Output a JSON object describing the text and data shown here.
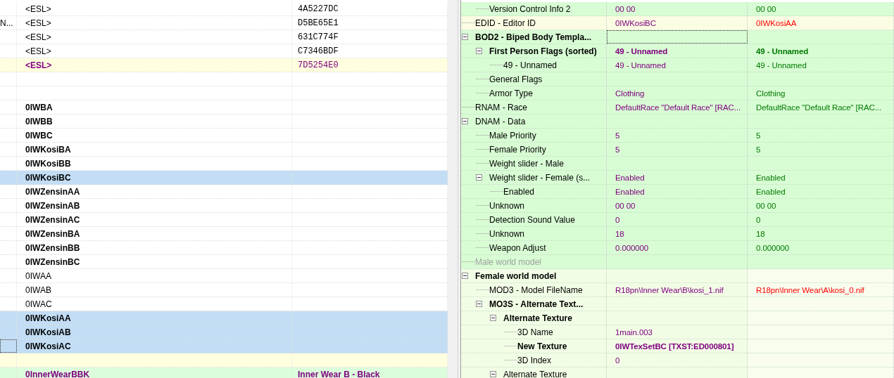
{
  "rows": [
    {
      "kind": "plain",
      "selected": false,
      "focused": false,
      "column_2": "<ESL>",
      "column_3": "4A5227DC"
    },
    {
      "kind": "plain",
      "selected": false,
      "focused": false,
      "column_1": "N...",
      "column_2": "<ESL>",
      "column_3": "D5BE65E1"
    },
    {
      "kind": "plain",
      "selected": false,
      "focused": false,
      "column_2": "<ESL>",
      "column_3": "631C774F"
    },
    {
      "kind": "plain",
      "selected": false,
      "focused": false,
      "column_2": "<ESL>",
      "column_3": "C7346BDF"
    },
    {
      "kind": "conflict",
      "selected": false,
      "focused": false,
      "column_2": "<ESL>",
      "column_3": "7D5254E0"
    },
    {
      "kind": "plain",
      "selected": false,
      "focused": false
    },
    {
      "kind": "plain",
      "selected": false,
      "focused": false
    },
    {
      "kind": "bold",
      "selected": false,
      "focused": false,
      "column_2": "0IWBA"
    },
    {
      "kind": "bold",
      "selected": false,
      "focused": false,
      "column_2": "0IWBB"
    },
    {
      "kind": "bold",
      "selected": false,
      "focused": false,
      "column_2": "0IWBC"
    },
    {
      "kind": "bold",
      "selected": false,
      "focused": false,
      "column_2": "0IWKosiBA"
    },
    {
      "kind": "bold",
      "selected": false,
      "focused": false,
      "column_2": "0IWKosiBB"
    },
    {
      "kind": "bold",
      "selected": true,
      "focused": false,
      "column_2": "0IWKosiBC"
    },
    {
      "kind": "bold",
      "selected": false,
      "focused": false,
      "column_2": "0IWZensinAA"
    },
    {
      "kind": "bold",
      "selected": false,
      "focused": false,
      "column_2": "0IWZensinAB"
    },
    {
      "kind": "bold",
      "selected": false,
      "focused": false,
      "column_2": "0IWZensinAC"
    },
    {
      "kind": "bold",
      "selected": false,
      "focused": false,
      "column_2": "0IWZensinBA"
    },
    {
      "kind": "bold",
      "selected": false,
      "focused": false,
      "column_2": "0IWZensinBB"
    },
    {
      "kind": "bold",
      "selected": false,
      "focused": false,
      "column_2": "0IWZensinBC"
    },
    {
      "kind": "plain",
      "selected": false,
      "focused": false,
      "column_2": "0IWAA"
    },
    {
      "kind": "plain",
      "selected": false,
      "focused": false,
      "column_2": "0IWAB"
    },
    {
      "kind": "plain",
      "selected": false,
      "focused": false,
      "column_2": "0IWAC"
    },
    {
      "kind": "bold",
      "selected": true,
      "focused": false,
      "column_2": "0IWKosiAA"
    },
    {
      "kind": "bold",
      "selected": true,
      "focused": false,
      "column_2": "0IWKosiAB"
    },
    {
      "kind": "bold",
      "selected": true,
      "focused": true,
      "column_2": "0IWKosiAC"
    },
    {
      "kind": "conflict",
      "selected": false,
      "focused": false
    },
    {
      "kind": "override",
      "selected": false,
      "focused": false,
      "column_2": "0InnerWearBBK",
      "column_3": "Inner Wear B - Black"
    }
  ],
  "tree": [
    {
      "children": [
        {
          "label": "Version Control Info 2",
          "kind": "match",
          "bold": false,
          "disabled": false,
          "focused": false,
          "values": [
            {
              "text": "00 00",
              "kind": "override"
            },
            {
              "text": "00 00",
              "kind": "same"
            }
          ]
        }
      ]
    },
    {
      "label": "EDID - Editor ID",
      "kind": "conflict",
      "bold": false,
      "disabled": false,
      "focused": false,
      "values": [
        {
          "text": "0IWKosiBC",
          "kind": "override"
        },
        {
          "text": "0IWKosiAA",
          "kind": "conflict"
        }
      ]
    },
    {
      "label": "BOD2 - Biped Body Templa...",
      "kind": "match",
      "bold": true,
      "disabled": false,
      "focused": true,
      "expanded": true,
      "children": [
        {
          "label": "First Person Flags (sorted)",
          "kind": "match",
          "bold": true,
          "disabled": false,
          "focused": false,
          "expanded": true,
          "values": [
            {
              "text": "49 - Unnamed",
              "kind": "override"
            },
            {
              "text": "49 - Unnamed",
              "kind": "same"
            }
          ],
          "children": [
            {
              "label": "49 - Unnamed",
              "kind": "match",
              "bold": false,
              "disabled": false,
              "focused": false,
              "values": [
                {
                  "text": "49 - Unnamed",
                  "kind": "override"
                },
                {
                  "text": "49 - Unnamed",
                  "kind": "same"
                }
              ]
            }
          ]
        },
        {
          "label": "General Flags",
          "kind": "match",
          "bold": false,
          "disabled": false,
          "focused": false
        },
        {
          "label": "Armor Type",
          "kind": "match",
          "bold": false,
          "disabled": false,
          "focused": false,
          "values": [
            {
              "text": "Clothing",
              "kind": "override"
            },
            {
              "text": "Clothing",
              "kind": "same"
            }
          ]
        }
      ]
    },
    {
      "label": "RNAM - Race",
      "kind": "match",
      "bold": false,
      "disabled": false,
      "focused": false,
      "values": [
        {
          "text": "DefaultRace \"Default Race\" [RAC...",
          "kind": "override"
        },
        {
          "text": "DefaultRace \"Default Race\" [RAC...",
          "kind": "same"
        }
      ]
    },
    {
      "label": "DNAM - Data",
      "kind": "match",
      "bold": false,
      "disabled": false,
      "focused": false,
      "expanded": true,
      "children": [
        {
          "label": "Male Priority",
          "kind": "match",
          "bold": false,
          "disabled": false,
          "focused": false,
          "values": [
            {
              "text": "5",
              "kind": "override"
            },
            {
              "text": "5",
              "kind": "same"
            }
          ]
        },
        {
          "label": "Female Priority",
          "kind": "match",
          "bold": false,
          "disabled": false,
          "focused": false,
          "values": [
            {
              "text": "5",
              "kind": "override"
            },
            {
              "text": "5",
              "kind": "same"
            }
          ]
        },
        {
          "label": "Weight slider - Male",
          "kind": "match",
          "bold": false,
          "disabled": false,
          "focused": false
        },
        {
          "label": "Weight slider - Female (s...",
          "kind": "match",
          "bold": false,
          "disabled": false,
          "focused": false,
          "expanded": true,
          "values": [
            {
              "text": "Enabled",
              "kind": "override"
            },
            {
              "text": "Enabled",
              "kind": "same"
            }
          ],
          "children": [
            {
              "label": "Enabled",
              "kind": "match",
              "bold": false,
              "disabled": false,
              "focused": false,
              "values": [
                {
                  "text": "Enabled",
                  "kind": "override"
                },
                {
                  "text": "Enabled",
                  "kind": "same"
                }
              ]
            }
          ]
        },
        {
          "label": "Unknown",
          "kind": "match",
          "bold": false,
          "disabled": false,
          "focused": false,
          "values": [
            {
              "text": "00 00",
              "kind": "override"
            },
            {
              "text": "00 00",
              "kind": "same"
            }
          ]
        },
        {
          "label": "Detection Sound Value",
          "kind": "match",
          "bold": false,
          "disabled": false,
          "focused": false,
          "values": [
            {
              "text": "0",
              "kind": "override"
            },
            {
              "text": "0",
              "kind": "same"
            }
          ]
        },
        {
          "label": "Unknown",
          "kind": "match",
          "bold": false,
          "disabled": false,
          "focused": false,
          "values": [
            {
              "text": "18",
              "kind": "override"
            },
            {
              "text": "18",
              "kind": "same"
            }
          ]
        },
        {
          "label": "Weapon Adjust",
          "kind": "match",
          "bold": false,
          "disabled": false,
          "focused": false,
          "values": [
            {
              "text": "0.000000",
              "kind": "override"
            },
            {
              "text": "0.000000",
              "kind": "same"
            }
          ]
        }
      ]
    },
    {
      "label": "Male world model",
      "kind": "match",
      "bold": false,
      "disabled": true,
      "focused": false
    },
    {
      "label": "Female world model",
      "kind": "absent",
      "bold": true,
      "disabled": false,
      "focused": false,
      "expanded": true,
      "children": [
        {
          "label": "MOD3 - Model FileName",
          "kind": "absent",
          "bold": false,
          "disabled": false,
          "focused": false,
          "values": [
            {
              "text": "R18pn\\Inner Wear\\B\\kosi_1.nif",
              "kind": "override"
            },
            {
              "text": "R18pn\\Inner Wear\\A\\kosi_0.nif",
              "kind": "conflict"
            }
          ]
        },
        {
          "label": "MO3S - Alternate Text...",
          "kind": "absent",
          "bold": true,
          "disabled": false,
          "focused": false,
          "expanded": true,
          "children": [
            {
              "label": "Alternate Texture",
              "kind": "absent",
              "bold": true,
              "disabled": false,
              "focused": false,
              "expanded": true,
              "children": [
                {
                  "label": "3D Name",
                  "kind": "absent",
                  "bold": false,
                  "disabled": false,
                  "focused": false,
                  "values": [
                    {
                      "text": "1main.003",
                      "kind": "override"
                    }
                  ]
                },
                {
                  "label": "New Texture",
                  "kind": "absent",
                  "bold": true,
                  "disabled": false,
                  "focused": false,
                  "values": [
                    {
                      "text": "0IWTexSetBC [TXST:ED000801]",
                      "kind": "override"
                    }
                  ]
                },
                {
                  "label": "3D Index",
                  "kind": "absent",
                  "bold": false,
                  "disabled": false,
                  "focused": false,
                  "values": [
                    {
                      "text": "0",
                      "kind": "override"
                    }
                  ]
                }
              ]
            },
            {
              "label": "Alternate Texture",
              "kind": "absent",
              "bold": false,
              "disabled": false,
              "focused": false,
              "expanded": true
            }
          ]
        }
      ]
    }
  ]
}
